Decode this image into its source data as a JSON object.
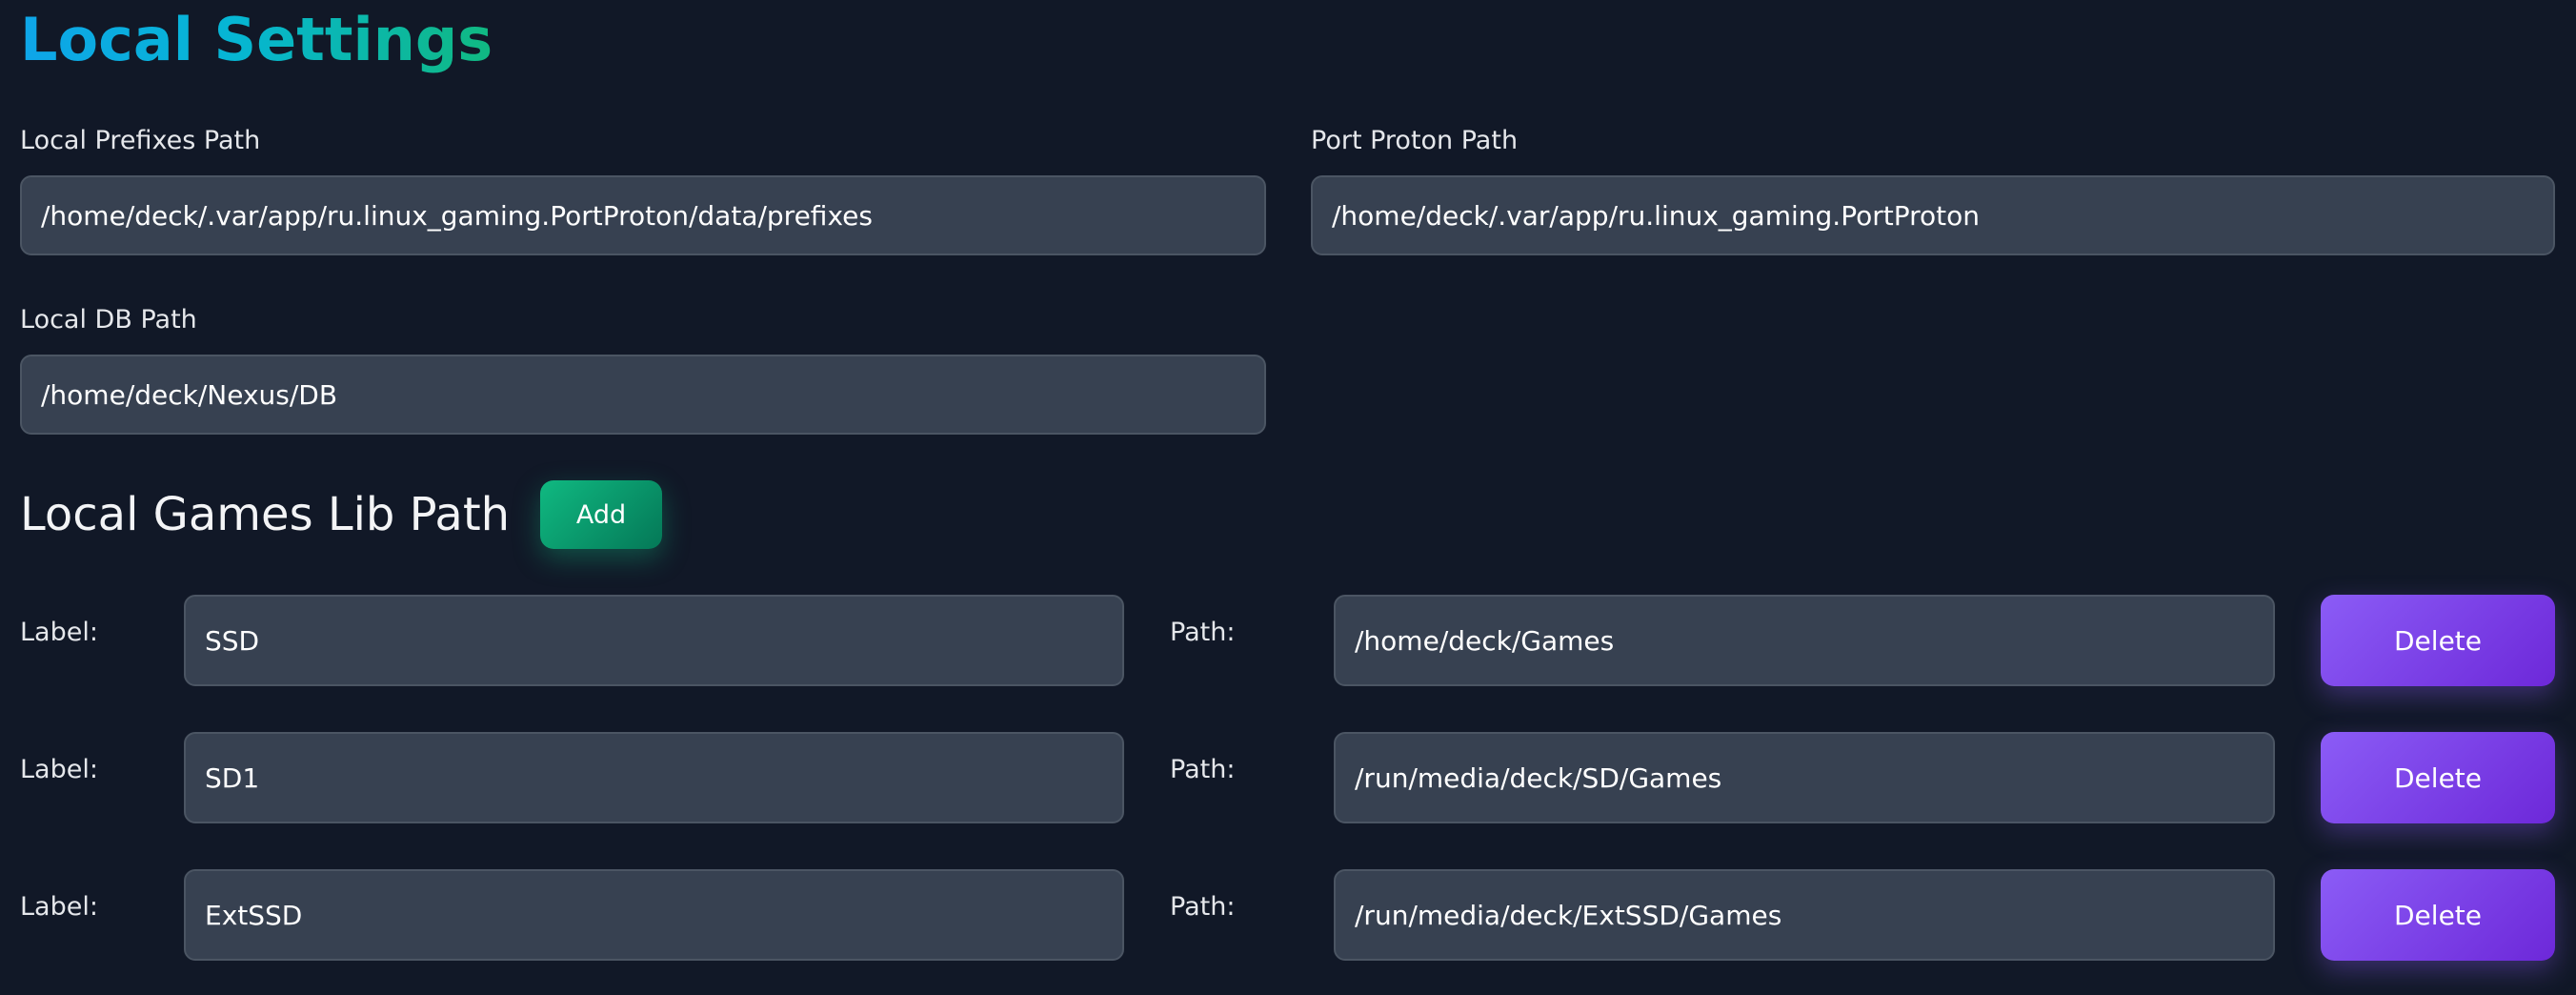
{
  "page": {
    "title": "Local Settings"
  },
  "settings": {
    "prefixes_path": {
      "label": "Local Prefixes Path",
      "value": "/home/deck/.var/app/ru.linux_gaming.PortProton/data/prefixes"
    },
    "port_proton_path": {
      "label": "Port Proton Path",
      "value": "/home/deck/.var/app/ru.linux_gaming.PortProton"
    },
    "db_path": {
      "label": "Local DB Path",
      "value": "/home/deck/Nexus/DB"
    }
  },
  "games_lib": {
    "heading": "Local Games Lib Path",
    "add_label": "Add",
    "label_caption": "Label:",
    "path_caption": "Path:",
    "delete_label": "Delete",
    "entries": [
      {
        "label": "SSD",
        "path": "/home/deck/Games"
      },
      {
        "label": "SD1",
        "path": "/run/media/deck/SD/Games"
      },
      {
        "label": "ExtSSD",
        "path": "/run/media/deck/ExtSSD/Games"
      }
    ]
  },
  "colors": {
    "background": "#111827",
    "input_background": "#374151",
    "add_accent": "#10b981",
    "delete_accent": "#8b5cf6"
  }
}
